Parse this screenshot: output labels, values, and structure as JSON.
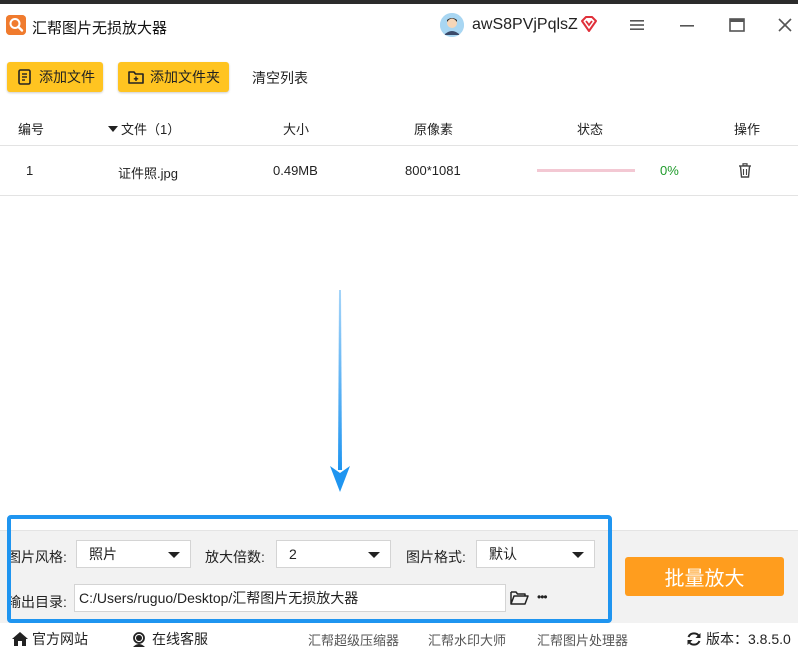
{
  "app": {
    "title": "汇帮图片无损放大器",
    "username": "awS8PVjPqlsZ",
    "icons": {
      "logo": "magnify-logo-icon",
      "avatar": "user-avatar",
      "vip": "vip-diamond-icon",
      "menu": "hamburger-menu-icon",
      "minimize": "minimize-icon",
      "maximize": "maximize-icon",
      "close": "close-icon"
    },
    "colors": {
      "accent_yellow": "#ffc421",
      "action_orange": "#ff9d1e",
      "highlight_blue": "#1f95f0",
      "progress_green": "#1f9b2b"
    }
  },
  "toolbar": {
    "add_file": "添加文件",
    "add_folder": "添加文件夹",
    "clear_list": "清空列表"
  },
  "table": {
    "headers": {
      "index": "编号",
      "file": "文件（1）",
      "size": "大小",
      "pixels": "原像素",
      "status": "状态",
      "action": "操作"
    },
    "rows": [
      {
        "index": "1",
        "name": "证件照.jpg",
        "size": "0.49MB",
        "pixels": "800*1081",
        "progress": "0%",
        "progress_value": 0
      }
    ]
  },
  "settings": {
    "style_label": "图片风格:",
    "style_value": "照片",
    "scale_label": "放大倍数:",
    "scale_value": "2",
    "format_label": "图片格式:",
    "format_value": "默认",
    "output_label": "输出目录:",
    "output_path": "C:/Users/ruguo/Desktop/汇帮图片无损放大器",
    "more": "•••",
    "start_button": "批量放大"
  },
  "statusbar": {
    "website": "官方网站",
    "support": "在线客服",
    "links": [
      "汇帮超级压缩器",
      "汇帮水印大师",
      "汇帮图片处理器"
    ],
    "version_label": "版本：",
    "version": "3.8.5.0"
  }
}
